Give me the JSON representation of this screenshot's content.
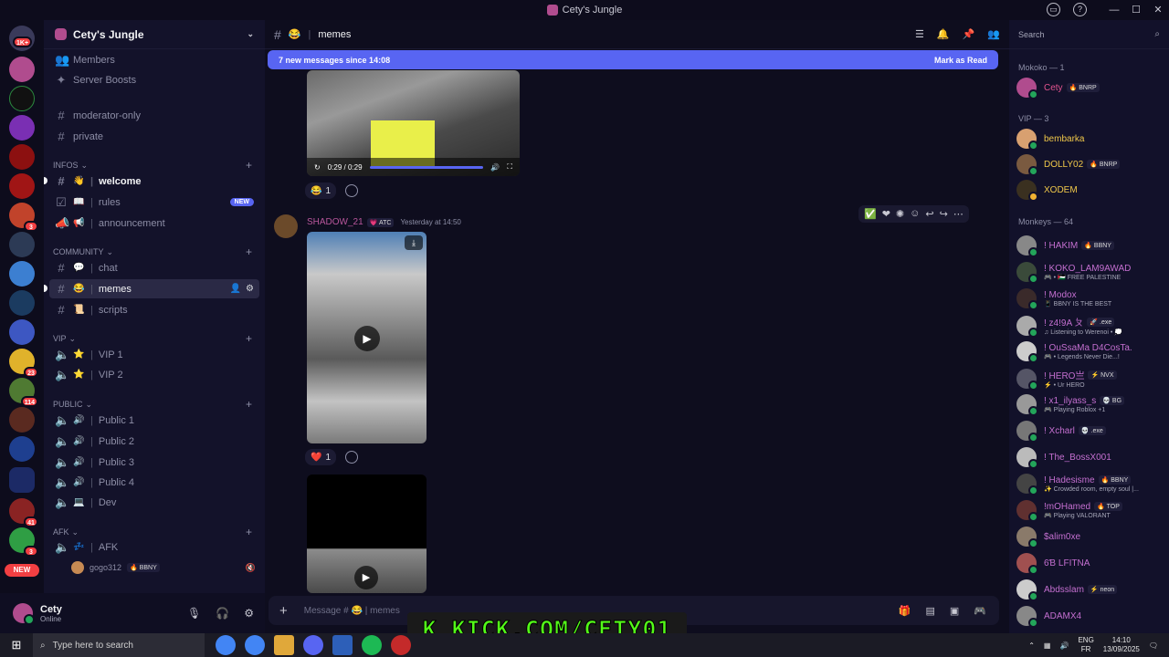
{
  "window": {
    "title": "Cety's Jungle",
    "controls": [
      "—",
      "☐",
      "✕"
    ]
  },
  "servers": {
    "home_badge": "1K+",
    "badges": [
      "3",
      "23",
      "114",
      "41",
      "3"
    ],
    "new_label": "NEW"
  },
  "guild": {
    "name": "Cety's Jungle",
    "top_items": [
      {
        "icon": "👥",
        "label": "Members"
      },
      {
        "icon": "✦",
        "label": "Server Boosts"
      }
    ],
    "loose_channels": [
      "moderator-only",
      "private"
    ],
    "categories": {
      "infos": "INFOS",
      "community": "COMMUNITY",
      "vip": "VIP",
      "public": "PUBLIC",
      "afk": "AFK"
    },
    "channels": {
      "welcome": {
        "emoji": "👋",
        "name": "welcome"
      },
      "rules": {
        "emoji": "📖",
        "name": "rules",
        "tag": "NEW"
      },
      "announcement": {
        "emoji": "📢",
        "name": "announcement"
      },
      "chat": {
        "emoji": "💬",
        "name": "chat"
      },
      "memes": {
        "emoji": "😂",
        "name": "memes"
      },
      "scripts": {
        "emoji": "📜",
        "name": "scripts"
      },
      "vip1": {
        "emoji": "⭐",
        "name": "VIP 1"
      },
      "vip2": {
        "emoji": "⭐",
        "name": "VIP 2"
      },
      "public1": {
        "emoji": "🔊",
        "name": "Public 1"
      },
      "public2": {
        "emoji": "🔊",
        "name": "Public 2"
      },
      "public3": {
        "emoji": "🔊",
        "name": "Public 3"
      },
      "public4": {
        "emoji": "🔊",
        "name": "Public 4"
      },
      "dev": {
        "emoji": "💻",
        "name": "Dev"
      },
      "afk": {
        "emoji": "💤",
        "name": "AFK"
      }
    },
    "voice_user": {
      "name": "gogo312",
      "tag": "🔥 BBNY"
    }
  },
  "user_panel": {
    "name": "Cety",
    "status": "Online"
  },
  "chat": {
    "channel_emoji": "😂",
    "channel_name": "memes",
    "new_messages": "7 new messages since 14:08",
    "mark_as_read": "Mark as Read",
    "video1": {
      "time": "0:29 / 0:29"
    },
    "reaction1": {
      "emoji": "😂",
      "count": "1"
    },
    "message": {
      "author": "SHADOW_21",
      "tag": "💗 ATC",
      "timestamp": "Yesterday at 14:50"
    },
    "reaction2": {
      "emoji": "❤️",
      "count": "1"
    },
    "composer_placeholder": "Message # 😂 | memes"
  },
  "members_panel": {
    "search_placeholder": "Search",
    "groups": {
      "mokoko": "Mokoko — 1",
      "vip": "VIP — 3",
      "monkeys": "Monkeys — 64"
    },
    "mokoko": [
      {
        "name": "Cety",
        "tag": "🔥 BNRP",
        "color": "#e3548f"
      }
    ],
    "vip": [
      {
        "name": "bembarka",
        "tag": "",
        "color": "#f0c84a"
      },
      {
        "name": "DOLLY02",
        "tag": "🔥 BNRP",
        "color": "#f0c84a"
      },
      {
        "name": "XODEM",
        "tag": "",
        "color": "#f0c84a"
      }
    ],
    "monkeys": [
      {
        "name": "! HAKIM",
        "tag": "🔥 BBNY",
        "activity": "",
        "color": "#c46fd0"
      },
      {
        "name": "! KOKO_LAM9AWAD",
        "tag": "",
        "activity": "🎮 • 🇵🇸 FREE PALESTINE",
        "color": "#c46fd0"
      },
      {
        "name": "! Modox",
        "tag": "",
        "activity": "📱 BBNY IS THE BEST",
        "color": "#c46fd0"
      },
      {
        "name": "! z4!9A ㄆ",
        "tag": "🚀 .exe",
        "activity": "♫ Listening to Werenoi • 💭",
        "color": "#c46fd0"
      },
      {
        "name": "! OuSsaMa D4CosTa.",
        "tag": "",
        "activity": "🎮 • Legends Never Die...!",
        "color": "#c46fd0"
      },
      {
        "name": "! HERO亗",
        "tag": "⚡ NVX",
        "activity": "⚡ • Ur HERO",
        "color": "#c46fd0"
      },
      {
        "name": "! x1_ilyass_s",
        "tag": "💀 BG",
        "activity": "🎮 Playing Roblox +1",
        "color": "#c46fd0"
      },
      {
        "name": "! Xcharl",
        "tag": "💀 .exe",
        "activity": "",
        "color": "#c46fd0"
      },
      {
        "name": "! The_BossX001",
        "tag": "",
        "activity": "",
        "color": "#c46fd0"
      },
      {
        "name": "! Hadesisme",
        "tag": "🔥 BBNY",
        "activity": "✨ Crowded room, empty soul |...",
        "color": "#c46fd0"
      },
      {
        "name": "!mOHamed",
        "tag": "🔥 TOP",
        "activity": "🎮 Playing VALORANT",
        "color": "#c46fd0"
      },
      {
        "name": "$alim0xe",
        "tag": "",
        "activity": "",
        "color": "#c46fd0"
      },
      {
        "name": "6Ɓ LFITNA",
        "tag": "",
        "activity": "",
        "color": "#c46fd0"
      },
      {
        "name": "Abdsslam",
        "tag": "⚡ neon",
        "activity": "",
        "color": "#c46fd0"
      },
      {
        "name": "ADAMX4",
        "tag": "",
        "activity": "",
        "color": "#c46fd0"
      }
    ]
  },
  "overlay": {
    "kick_text": "K KICK.COM/CETY01"
  },
  "taskbar": {
    "search_placeholder": "Type here to search",
    "lang_top": "ENG",
    "lang_bottom": "FR",
    "time": "14:10",
    "date": "13/09/2025"
  }
}
